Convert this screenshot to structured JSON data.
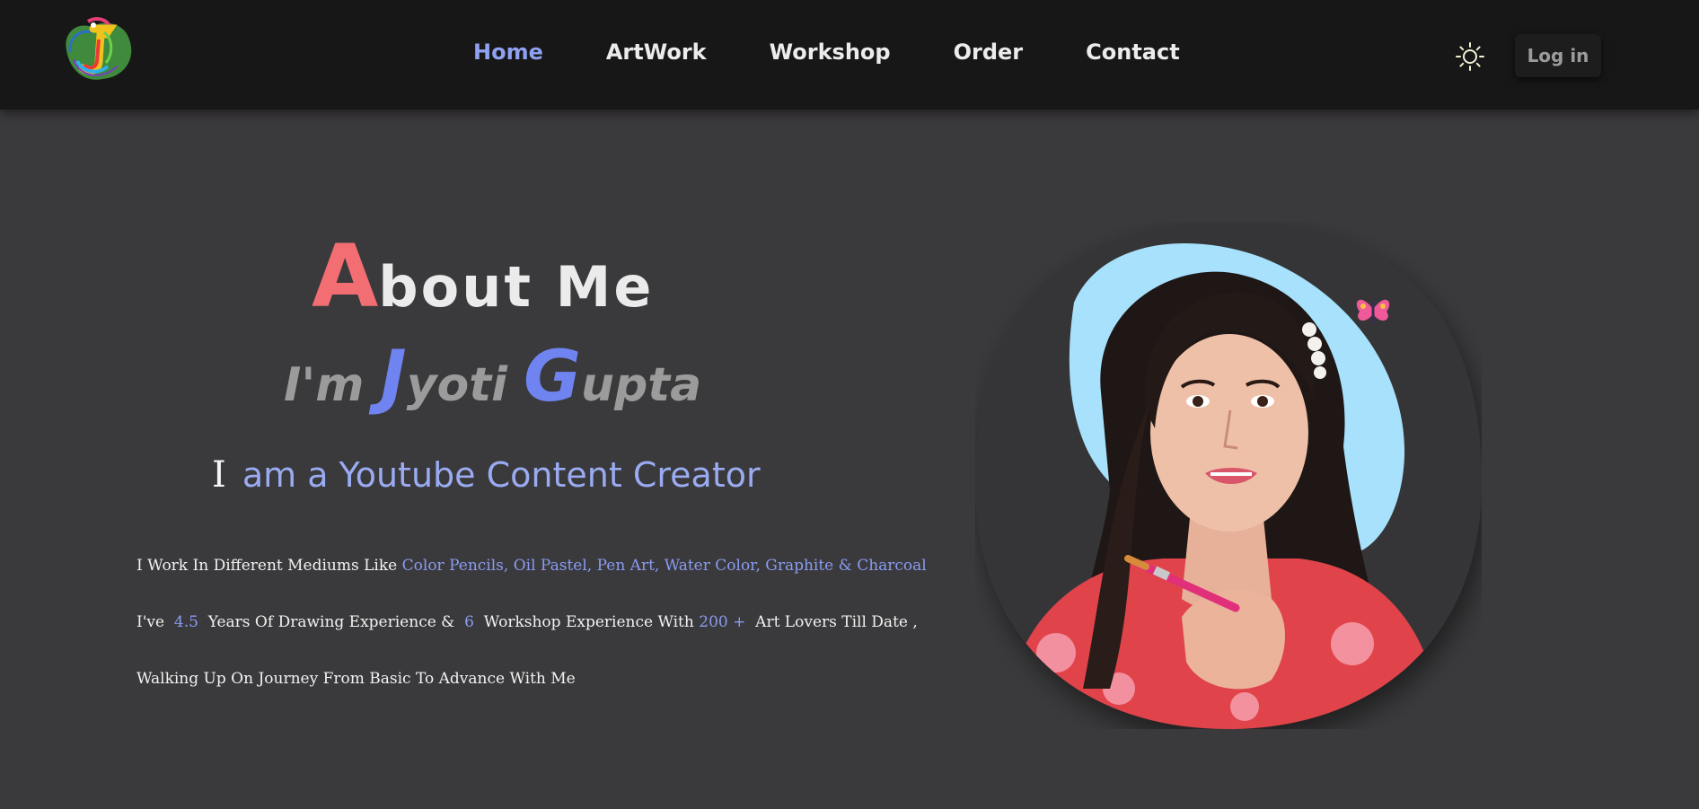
{
  "nav": {
    "logo_icon": "jg-colorful-logo",
    "links": [
      {
        "label": "Home",
        "active": true
      },
      {
        "label": "ArtWork",
        "active": false
      },
      {
        "label": "Workshop",
        "active": false
      },
      {
        "label": "Order",
        "active": false
      },
      {
        "label": "Contact",
        "active": false
      }
    ],
    "theme_icon": "sun-icon",
    "login_label": "Log in"
  },
  "about": {
    "title_first_letter": "A",
    "title_rest": "bout Me",
    "intro": "I'm",
    "first_initial": "J",
    "first_rest": "yoti",
    "last_initial": "G",
    "last_rest": "upta",
    "cursor_letter": "I",
    "role": "am a Youtube Content Creator",
    "line1_prefix": "I Work In Different Mediums Like",
    "line1_highlight": "Color Pencils, Oil Pastel, Pen Art, Water Color, Graphite & Charcoal",
    "line2_a": "I've",
    "line2_years": "4.5",
    "line2_b": "Years Of Drawing Experience &",
    "line2_workshops": "6",
    "line2_c": "Workshop Experience With",
    "line2_lovers": "200 +",
    "line2_d": "Art Lovers Till Date ,",
    "line3": "Walking Up On Journey From Basic To Advance With Me"
  },
  "colors": {
    "background": "#3a393b",
    "navbar": "#171717",
    "accent_blue": "#6f84f0",
    "accent_light_blue": "#9aabf2",
    "accent_red": "#f36e72",
    "blob": "#a7e1fb"
  },
  "portrait": {
    "alt": "portrait-photo",
    "decoration_icon": "butterfly-icon"
  }
}
